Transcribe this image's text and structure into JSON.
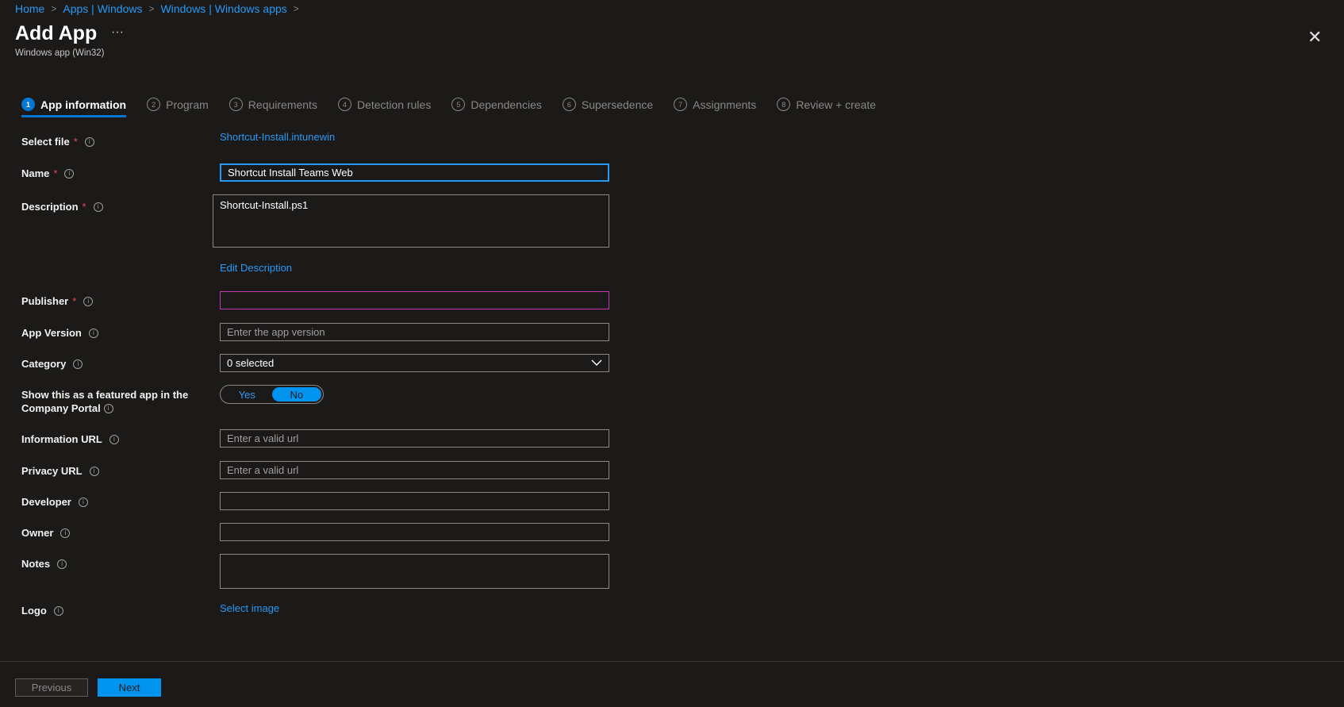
{
  "breadcrumb": [
    "Home",
    "Apps | Windows",
    "Windows | Windows apps"
  ],
  "header": {
    "title": "Add App",
    "more": "···",
    "subtitle": "Windows app (Win32)",
    "close": "✕"
  },
  "tabs": [
    {
      "num": "1",
      "label": "App information"
    },
    {
      "num": "2",
      "label": "Program"
    },
    {
      "num": "3",
      "label": "Requirements"
    },
    {
      "num": "4",
      "label": "Detection rules"
    },
    {
      "num": "5",
      "label": "Dependencies"
    },
    {
      "num": "6",
      "label": "Supersedence"
    },
    {
      "num": "7",
      "label": "Assignments"
    },
    {
      "num": "8",
      "label": "Review + create"
    }
  ],
  "form": {
    "select_file": {
      "label": "Select file",
      "value": "Shortcut-Install.intunewin"
    },
    "name": {
      "label": "Name",
      "value": "Shortcut Install Teams Web"
    },
    "description": {
      "label": "Description",
      "value": "Shortcut-Install.ps1",
      "edit_link": "Edit Description"
    },
    "publisher": {
      "label": "Publisher",
      "value": ""
    },
    "app_version": {
      "label": "App Version",
      "placeholder": "Enter the app version"
    },
    "category": {
      "label": "Category",
      "value": "0 selected"
    },
    "featured": {
      "label_line1": "Show this as a featured app in the",
      "label_line2": "Company Portal",
      "yes": "Yes",
      "no": "No",
      "selected": "No"
    },
    "information_url": {
      "label": "Information URL",
      "placeholder": "Enter a valid url"
    },
    "privacy_url": {
      "label": "Privacy URL",
      "placeholder": "Enter a valid url"
    },
    "developer": {
      "label": "Developer",
      "value": ""
    },
    "owner": {
      "label": "Owner",
      "value": ""
    },
    "notes": {
      "label": "Notes",
      "value": ""
    },
    "logo": {
      "label": "Logo",
      "link": "Select image"
    },
    "required_mark": "*",
    "info_glyph": "i"
  },
  "footer": {
    "previous": "Previous",
    "next": "Next"
  }
}
